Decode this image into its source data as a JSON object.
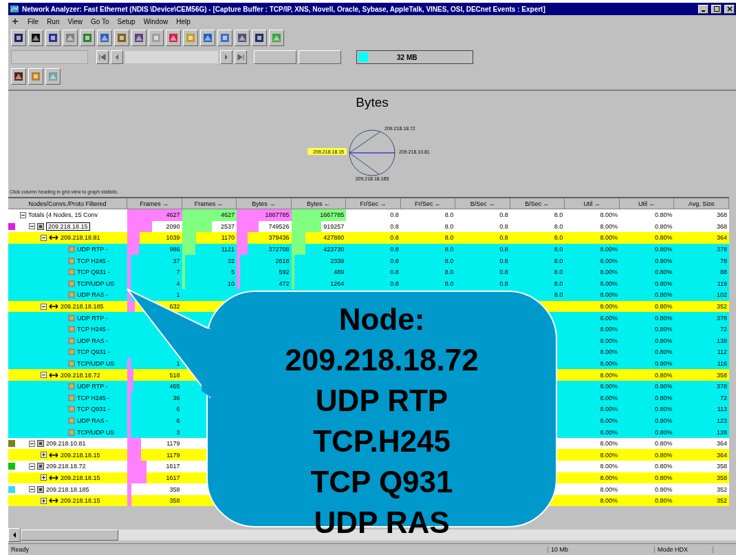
{
  "window": {
    "title": "Network Analyzer: Fast Ethernet (NDIS \\Device\\CEM56G) - [Capture Buffer : TCP/IP, XNS, Novell, Oracle, Sybase, AppleTalk, VINES, OSI, DECnet Events : Expert]"
  },
  "menu": [
    "File",
    "Run",
    "View",
    "Go To",
    "Setup",
    "Window",
    "Help"
  ],
  "buffer": {
    "size": "32 MB"
  },
  "graph": {
    "title": "Bytes",
    "nodes": [
      {
        "label": "209.218.18.72",
        "highlighted": false
      },
      {
        "label": "209.218.10.81",
        "highlighted": false
      },
      {
        "label": "209.218.18.185",
        "highlighted": false
      },
      {
        "label": "209.218.18.15",
        "highlighted": true
      }
    ]
  },
  "hint": "Click column heading in grid view to graph statistic.",
  "table": {
    "columns": [
      "Nodes/Convs./Proto Filtered",
      "Frames →",
      "Frames ←",
      "Bytes →",
      "Bytes ←",
      "Fr/Sec →",
      "Fr/Sec ←",
      "B/Sec →",
      "B/Sec ←",
      "Util →",
      "Util ←",
      "Avg. Size"
    ],
    "totals": {
      "label": "Totals (4 Nodes, 15 Conv",
      "cells": [
        "4627",
        "4627",
        "1867785",
        "1667785",
        "0.8",
        "8.0",
        "0.8",
        "8.0",
        "8.00%",
        "0.80%",
        "368"
      ]
    },
    "nodes": [
      {
        "label": "209.218.18.15",
        "color": "#e020e0",
        "expanded": true,
        "cells": [
          "2090",
          "2537",
          "749526",
          "919257",
          "0.8",
          "8.0",
          "0.8",
          "8.0",
          "8.00%",
          "0.80%",
          "368"
        ],
        "children": [
          {
            "label": "209.218.18.81",
            "expanded": true,
            "cells": [
              "1039",
              "1170",
              "379436",
              "427880",
              "0.8",
              "8.0",
              "0.8",
              "8.0",
              "8.00%",
              "0.80%",
              "364"
            ],
            "children": [
              {
                "label": "UDP RTP -",
                "cells": [
                  "986",
                  "1121",
                  "372708",
                  "423730",
                  "0.8",
                  "8.0",
                  "0.8",
                  "8.0",
                  "8.00%",
                  "0.80%",
                  "378"
                ]
              },
              {
                "label": "TCP H245 -",
                "cells": [
                  "37",
                  "32",
                  "2618",
                  "2339",
                  "0.8",
                  "8.0",
                  "0.8",
                  "8.0",
                  "8.00%",
                  "0.80%",
                  "78"
                ]
              },
              {
                "label": "TCP Q931 -",
                "cells": [
                  "7",
                  "5",
                  "592",
                  "489",
                  "0.8",
                  "8.0",
                  "0.8",
                  "8.0",
                  "8.00%",
                  "0.80%",
                  "88"
                ]
              },
              {
                "label": "TCP/UDP US",
                "cells": [
                  "4",
                  "10",
                  "472",
                  "1264",
                  "0.8",
                  "8.0",
                  "0.8",
                  "8.0",
                  "8.00%",
                  "0.80%",
                  "119"
                ]
              },
              {
                "label": "UDP RAS -",
                "cells": [
                  "1",
                  null,
                  null,
                  null,
                  null,
                  null,
                  null,
                  "8.0",
                  "8.00%",
                  "0.80%",
                  "102"
                ]
              }
            ]
          },
          {
            "label": "209.218.18.185",
            "expanded": true,
            "cells": [
              "632",
              null,
              null,
              null,
              null,
              null,
              null,
              null,
              "8.00%",
              "0.80%",
              "352"
            ],
            "children": [
              {
                "label": "UDP RTP -",
                "cells": [
                  null,
                  null,
                  null,
                  null,
                  null,
                  null,
                  null,
                  null,
                  "8.00%",
                  "0.80%",
                  "378"
                ]
              },
              {
                "label": "TCP H245 -",
                "cells": [
                  null,
                  null,
                  null,
                  null,
                  null,
                  null,
                  null,
                  null,
                  "8.00%",
                  "0.80%",
                  "72"
                ]
              },
              {
                "label": "UDP RAS -",
                "cells": [
                  null,
                  null,
                  null,
                  null,
                  null,
                  null,
                  null,
                  null,
                  "8.00%",
                  "0.80%",
                  "138"
                ]
              },
              {
                "label": "TCP Q931 -",
                "cells": [
                  null,
                  null,
                  null,
                  null,
                  null,
                  null,
                  null,
                  null,
                  "8.00%",
                  "0.80%",
                  "112"
                ]
              },
              {
                "label": "TCP/UDP US",
                "cells": [
                  "1",
                  null,
                  null,
                  null,
                  null,
                  null,
                  null,
                  null,
                  "8.00%",
                  "0.80%",
                  "116"
                ]
              }
            ]
          },
          {
            "label": "209.218.18.72",
            "expanded": true,
            "cells": [
              "518",
              null,
              null,
              null,
              null,
              null,
              null,
              null,
              "8.00%",
              "0.80%",
              "358"
            ],
            "children": [
              {
                "label": "UDP RTP -",
                "cells": [
                  "465",
                  null,
                  null,
                  null,
                  null,
                  null,
                  null,
                  null,
                  "8.00%",
                  "0.80%",
                  "378"
                ]
              },
              {
                "label": "TCP H245 -",
                "cells": [
                  "36",
                  null,
                  null,
                  null,
                  null,
                  null,
                  null,
                  null,
                  "8.00%",
                  "0.80%",
                  "72"
                ]
              },
              {
                "label": "TCP Q931 -",
                "cells": [
                  "6",
                  null,
                  null,
                  null,
                  null,
                  null,
                  null,
                  null,
                  "8.00%",
                  "0.80%",
                  "113"
                ]
              },
              {
                "label": "UDP RAS -",
                "cells": [
                  "6",
                  null,
                  null,
                  null,
                  null,
                  null,
                  null,
                  null,
                  "8.00%",
                  "0.80%",
                  "123"
                ]
              },
              {
                "label": "TCP/UDP US",
                "cells": [
                  "3",
                  null,
                  null,
                  null,
                  null,
                  null,
                  null,
                  null,
                  "8.00%",
                  "0.80%",
                  "128"
                ]
              }
            ]
          }
        ]
      },
      {
        "label": "209.218.10.81",
        "color": "#808020",
        "expanded": true,
        "cells": [
          "1179",
          null,
          null,
          null,
          null,
          null,
          null,
          null,
          "8.00%",
          "0.80%",
          "364"
        ],
        "children": [
          {
            "label": "209.218.18.15",
            "expanded": false,
            "cells": [
              "1179",
              null,
              null,
              null,
              null,
              null,
              null,
              null,
              "8.00%",
              "0.80%",
              "364"
            ]
          }
        ]
      },
      {
        "label": "209.218.18.72",
        "color": "#10c010",
        "expanded": true,
        "cells": [
          "1617",
          null,
          null,
          null,
          null,
          null,
          null,
          null,
          "8.00%",
          "0.80%",
          "358"
        ],
        "children": [
          {
            "label": "209.218.18.15",
            "expanded": false,
            "cells": [
              "1617",
              null,
              null,
              null,
              null,
              null,
              null,
              null,
              "8.00%",
              "0.80%",
              "358"
            ]
          }
        ]
      },
      {
        "label": "209.218.18.185",
        "color": "#40d8f0",
        "expanded": true,
        "cells": [
          "358",
          null,
          null,
          null,
          null,
          null,
          null,
          null,
          "8.00%",
          "0.80%",
          "352"
        ],
        "children": [
          {
            "label": "209.218.18.15",
            "expanded": false,
            "cells": [
              "358",
              null,
              null,
              null,
              null,
              null,
              null,
              null,
              "8.00%",
              "0.80%",
              "352"
            ]
          }
        ]
      }
    ]
  },
  "status_bar": {
    "left": "Ready",
    "speed": "10 Mb",
    "mode": "Mode HDX"
  },
  "callout": {
    "lines": [
      "Node:",
      "209.218.18.72",
      "UDP RTP",
      "TCP.H245",
      "TCP Q931",
      "UDP RAS"
    ]
  }
}
